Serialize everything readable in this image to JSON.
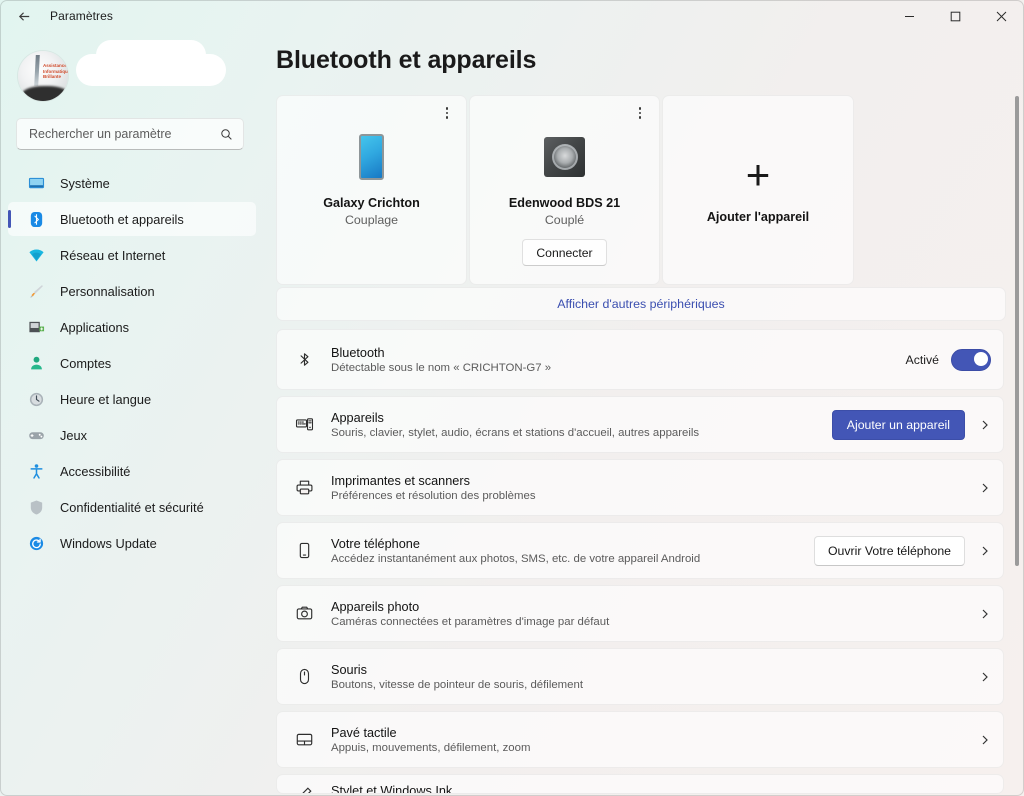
{
  "window": {
    "title": "Paramètres",
    "back_icon": "back-arrow-icon",
    "minimize_label": "–",
    "maximize_label": "□",
    "close_label": "×"
  },
  "sidebar": {
    "search": {
      "placeholder": "Rechercher un paramètre",
      "value": ""
    },
    "items": [
      {
        "label": "Système",
        "icon": "monitor-icon"
      },
      {
        "label": "Bluetooth et appareils",
        "icon": "bluetooth-icon"
      },
      {
        "label": "Réseau et Internet",
        "icon": "wifi-icon"
      },
      {
        "label": "Personnalisation",
        "icon": "paintbrush-icon"
      },
      {
        "label": "Applications",
        "icon": "apps-icon"
      },
      {
        "label": "Comptes",
        "icon": "person-icon"
      },
      {
        "label": "Heure et langue",
        "icon": "clock-icon"
      },
      {
        "label": "Jeux",
        "icon": "gamepad-icon"
      },
      {
        "label": "Accessibilité",
        "icon": "accessibility-icon"
      },
      {
        "label": "Confidentialité et sécurité",
        "icon": "shield-icon"
      },
      {
        "label": "Windows Update",
        "icon": "update-icon"
      }
    ],
    "active_index": 1
  },
  "main": {
    "page_title": "Bluetooth et appareils",
    "device_cards": [
      {
        "name": "Galaxy Crichton",
        "state": "Couplage",
        "icon": "phone-icon",
        "menu_icon": "more-vertical-icon",
        "action": null
      },
      {
        "name": "Edenwood BDS 21",
        "state": "Couplé",
        "icon": "speaker-icon",
        "menu_icon": "more-vertical-icon",
        "action": "Connecter"
      }
    ],
    "add_device_card": {
      "label": "Ajouter l'appareil",
      "icon": "plus-icon"
    },
    "show_more_link": "Afficher d'autres périphériques",
    "rows": [
      {
        "title": "Bluetooth",
        "subtitle": "Détectable sous le nom « CRICHTON-G7 »",
        "icon": "bluetooth-outline-icon",
        "state_label": "Activé",
        "control": "toggle",
        "toggle_on": true,
        "chevron": false
      },
      {
        "title": "Appareils",
        "subtitle": "Souris, clavier, stylet, audio, écrans et stations d'accueil, autres appareils",
        "icon": "devices-icon",
        "button": "Ajouter un appareil",
        "button_style": "accent",
        "chevron": true
      },
      {
        "title": "Imprimantes et scanners",
        "subtitle": "Préférences et résolution des problèmes",
        "icon": "printer-icon",
        "chevron": true
      },
      {
        "title": "Votre téléphone",
        "subtitle": "Accédez instantanément aux photos, SMS, etc. de votre appareil Android",
        "icon": "phone-outline-icon",
        "button": "Ouvrir Votre téléphone",
        "button_style": "plain",
        "chevron": true
      },
      {
        "title": "Appareils photo",
        "subtitle": "Caméras connectées et paramètres d'image par défaut",
        "icon": "camera-icon",
        "chevron": true
      },
      {
        "title": "Souris",
        "subtitle": "Boutons, vitesse de pointeur de souris, défilement",
        "icon": "mouse-icon",
        "chevron": true
      },
      {
        "title": "Pavé tactile",
        "subtitle": "Appuis, mouvements, défilement, zoom",
        "icon": "touchpad-icon",
        "chevron": true
      }
    ],
    "clipped_row": {
      "title": "Stylet et Windows Ink",
      "icon": "pen-icon"
    }
  },
  "colors": {
    "accent": "#4356b6",
    "sidebar_bg": "#e2f5f0",
    "content_bg": "#f6f0ee",
    "link": "#3b4fb0"
  }
}
